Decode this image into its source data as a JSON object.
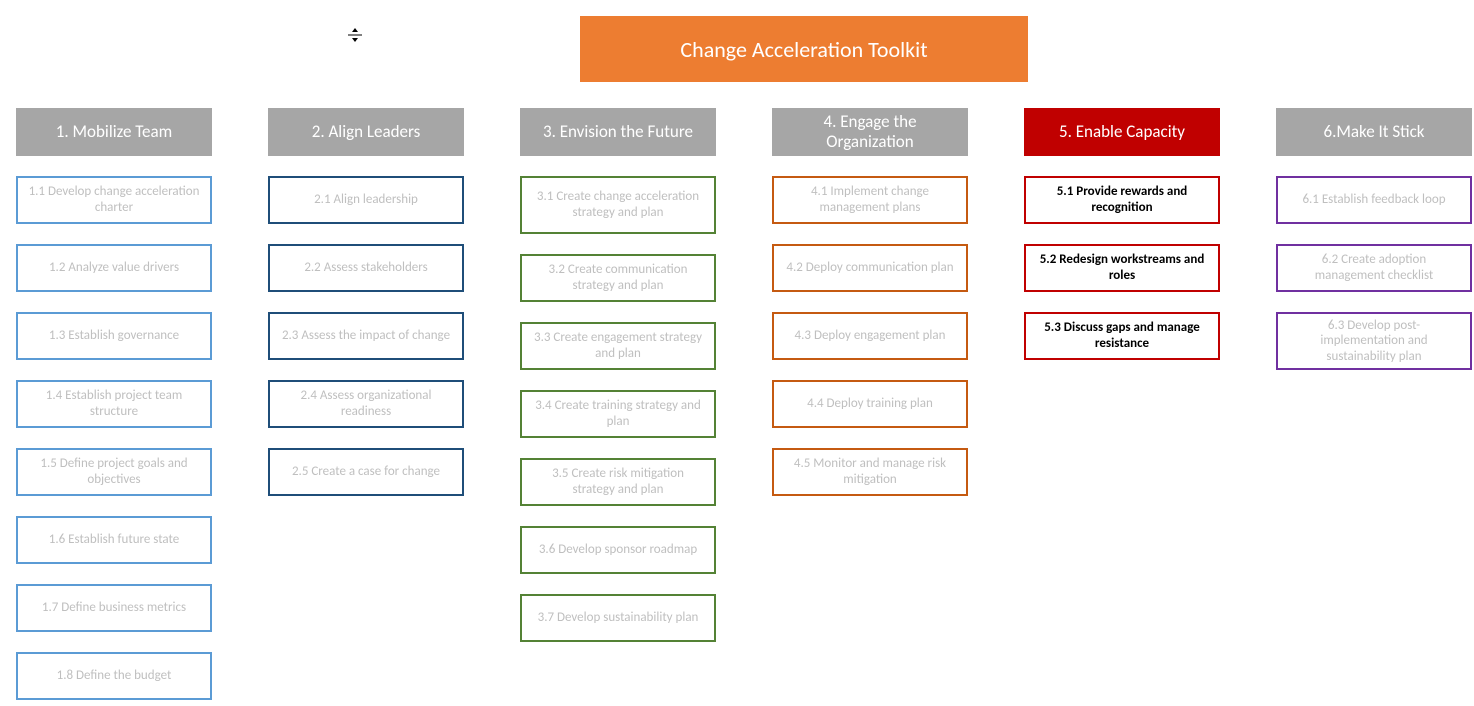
{
  "title": "Change Acceleration Toolkit",
  "columns": [
    {
      "header": "1. Mobilize Team",
      "headerClass": "hdr-gray",
      "boxClass": "blue",
      "items": [
        "1.1 Develop change acceleration charter",
        "1.2 Analyze value drivers",
        "1.3 Establish governance",
        "1.4 Establish project team structure",
        "1.5 Define project goals and objectives",
        "1.6 Establish future state",
        "1.7 Define business metrics",
        "1.8 Define the budget"
      ]
    },
    {
      "header": "2. Align Leaders",
      "headerClass": "hdr-gray",
      "boxClass": "navy",
      "items": [
        "2.1 Align leadership",
        "2.2 Assess stakeholders",
        "2.3 Assess the impact of change",
        "2.4 Assess organizational readiness",
        "2.5 Create a case for change"
      ]
    },
    {
      "header": "3. Envision the Future",
      "headerClass": "hdr-gray",
      "boxClass": "green",
      "items": [
        "3.1 Create change acceleration strategy and plan",
        "3.2 Create communication strategy and plan",
        "3.3 Create engagement strategy and plan",
        "3.4 Create training strategy and plan",
        "3.5 Create risk mitigation strategy and plan",
        "3.6 Develop sponsor roadmap",
        "3.7 Develop sustainability plan"
      ]
    },
    {
      "header": "4. Engage the Organization",
      "headerClass": "hdr-gray",
      "boxClass": "brown",
      "items": [
        "4.1 Implement change management plans",
        "4.2 Deploy communication plan",
        "4.3 Deploy engagement plan",
        "4.4 Deploy training plan",
        "4.5 Monitor and manage risk mitigation"
      ]
    },
    {
      "header": "5. Enable Capacity",
      "headerClass": "hdr-red",
      "boxClass": "red",
      "items": [
        "5.1 Provide rewards and recognition",
        "5.2 Redesign workstreams and roles",
        "5.3 Discuss gaps and manage resistance"
      ]
    },
    {
      "header": "6.Make It Stick",
      "headerClass": "hdr-gray",
      "boxClass": "purple",
      "items": [
        "6.1 Establish feedback loop",
        "6.2 Create adoption management checklist",
        "6.3 Develop post-implementation and sustainability plan"
      ]
    }
  ]
}
